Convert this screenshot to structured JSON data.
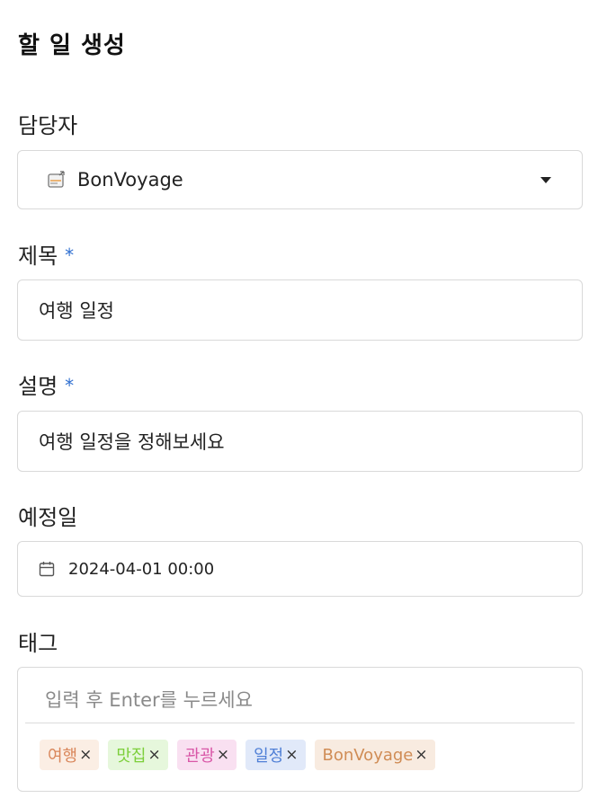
{
  "page": {
    "title": "할 일 생성"
  },
  "assignee": {
    "label": "담당자",
    "value": "BonVoyage"
  },
  "title_field": {
    "label": "제목",
    "required_mark": "*",
    "value": "여행 일정"
  },
  "description_field": {
    "label": "설명",
    "required_mark": "*",
    "value": "여행 일정을 정해보세요"
  },
  "due_date": {
    "label": "예정일",
    "value": "2024-04-01 00:00"
  },
  "tags": {
    "label": "태그",
    "placeholder": "입력 후 Enter를 누르세요",
    "remove_symbol": "×",
    "items": [
      {
        "label": "여행",
        "text_color": "#d9865a",
        "bg_color": "#fbeee4"
      },
      {
        "label": "맛집",
        "text_color": "#7ccf3a",
        "bg_color": "#e6f7dc"
      },
      {
        "label": "관광",
        "text_color": "#d957a7",
        "bg_color": "#f9e0f1"
      },
      {
        "label": "일정",
        "text_color": "#4f7fd6",
        "bg_color": "#e1e9f9"
      },
      {
        "label": "BonVoyage",
        "text_color": "#d08c55",
        "bg_color": "#f8ebe0"
      }
    ]
  },
  "colors": {
    "required": "#2f6fd0",
    "border": "#d9d9d9"
  }
}
